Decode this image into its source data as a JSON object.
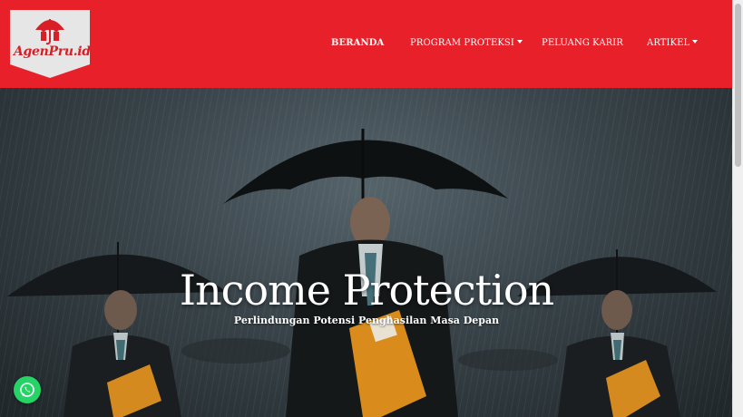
{
  "brand": {
    "logo_text": "AgenPru.id"
  },
  "nav": {
    "items": [
      {
        "label": "BERANDA",
        "active": true,
        "dropdown": false
      },
      {
        "label": "PROGRAM PROTEKSI",
        "active": false,
        "dropdown": true
      },
      {
        "label": "PELUANG KARIR",
        "active": false,
        "dropdown": false
      },
      {
        "label": "ARTIKEL",
        "active": false,
        "dropdown": true
      }
    ]
  },
  "hero": {
    "title": "Income Protection",
    "subtitle": "Perlindungan Potensi Penghasilan Masa Depan"
  },
  "colors": {
    "brand_red": "#e8202a",
    "whatsapp_green": "#25d366"
  },
  "icons": {
    "whatsapp": "whatsapp-icon",
    "umbrella_logo": "umbrella-icon"
  }
}
